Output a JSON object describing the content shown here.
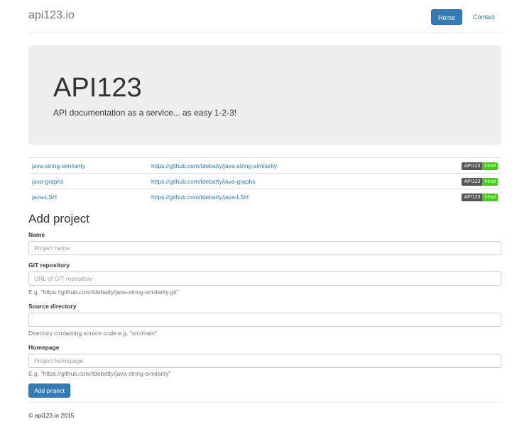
{
  "header": {
    "brand": "api123.io",
    "nav": [
      {
        "label": "Home",
        "active": true
      },
      {
        "label": "Contact",
        "active": false
      }
    ]
  },
  "jumbotron": {
    "title": "API123",
    "subtitle": "API documentation as a service... as easy 1-2-3!"
  },
  "projects": [
    {
      "name": "java-string-similarity",
      "url": "https://github.com/tdebatty/java-string-similarity",
      "badge_left": "API123",
      "badge_right": "head"
    },
    {
      "name": "java-graphs",
      "url": "https://github.com/tdebatty/java-graphs",
      "badge_left": "API123",
      "badge_right": "head"
    },
    {
      "name": "java-LSH",
      "url": "https://github.com/tdebatty/java-LSH",
      "badge_left": "API123",
      "badge_right": "head"
    }
  ],
  "form": {
    "title": "Add project",
    "name_label": "Name",
    "name_placeholder": "Project name",
    "git_label": "GIT repository",
    "git_placeholder": "URL of GIT repository",
    "git_help": "E.g. \"https://github.com/tdebatty/java-string-similarity.git\"",
    "source_label": "Source directory",
    "source_placeholder": "",
    "source_help": "Directory containing source code e.g. \"src/main\"",
    "homepage_label": "Homepage",
    "homepage_placeholder": "Project homepage",
    "homepage_help": "E.g. \"https://github.com/tdebatty/java-string-similarity\"",
    "submit_label": "Add project"
  },
  "footer": {
    "copyright": "© api123.io 2015"
  },
  "colors": {
    "primary": "#337ab7",
    "jumbotron_bg": "#eeeeee",
    "badge_left": "#555555",
    "badge_right": "#44cc11"
  }
}
